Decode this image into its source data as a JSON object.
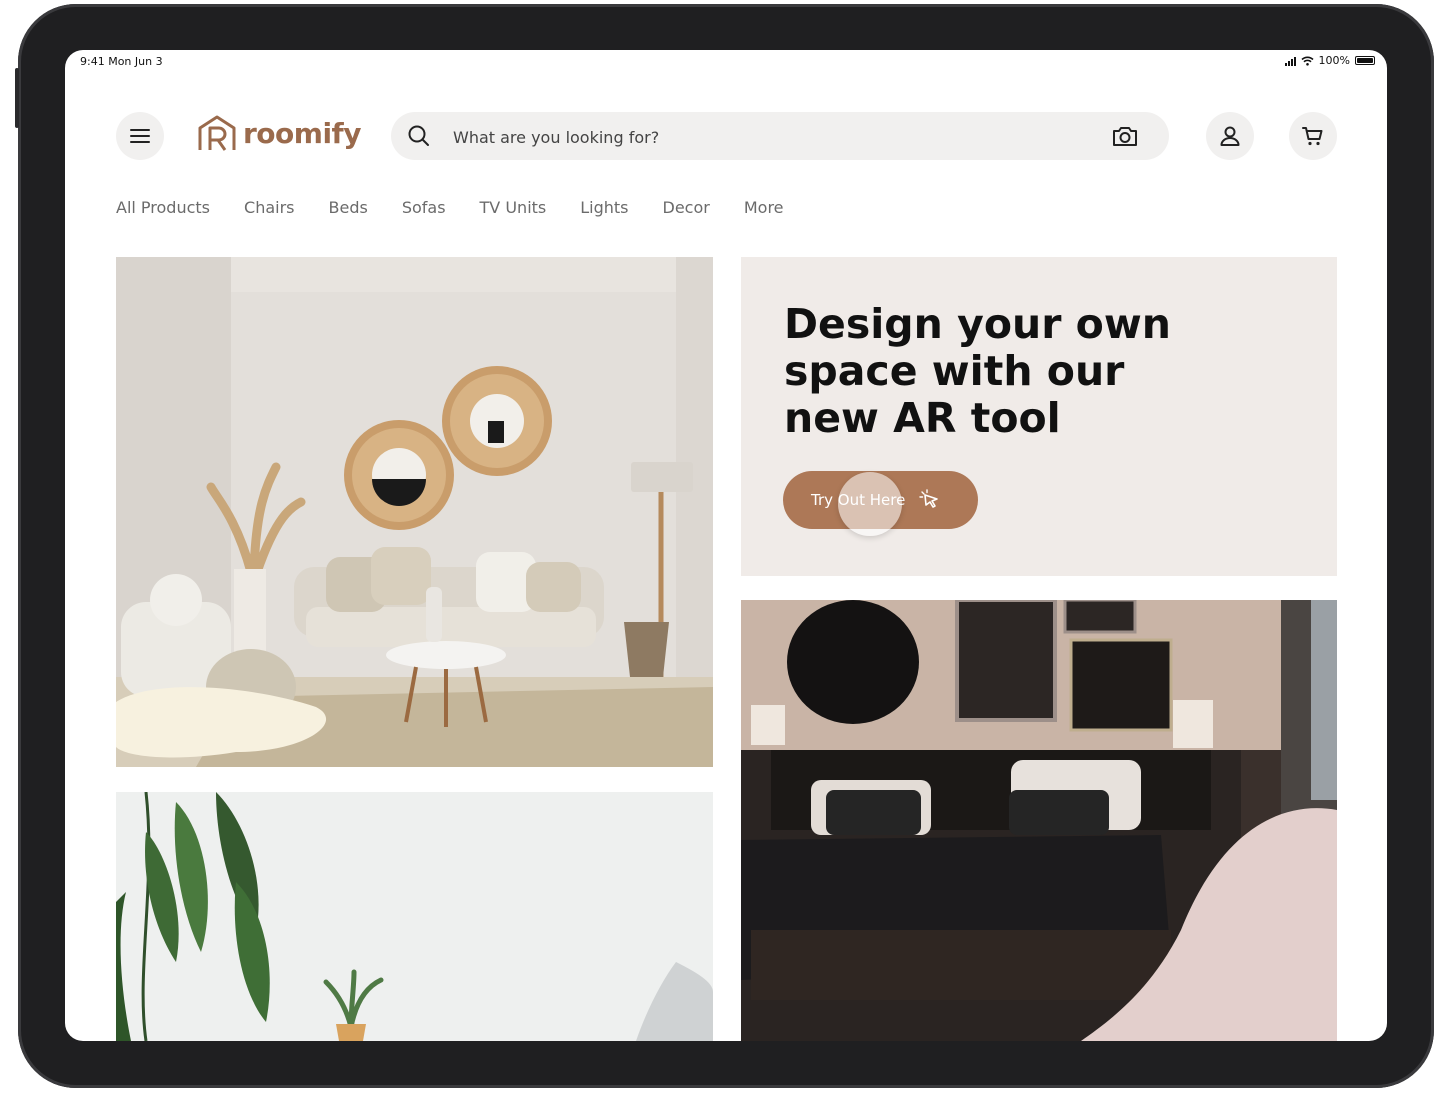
{
  "status_bar": {
    "time": "9:41 Mon Jun 3",
    "battery": "100%"
  },
  "header": {
    "brand": "roomify",
    "search_placeholder": "What are you looking for?",
    "icons": {
      "menu": "menu-icon",
      "search": "search-icon",
      "camera": "camera-icon",
      "account": "user-icon",
      "cart": "cart-icon"
    }
  },
  "nav": {
    "items": [
      "All Products",
      "Chairs",
      "Beds",
      "Sofas",
      "TV Units",
      "Lights",
      "Decor",
      "More"
    ]
  },
  "promo": {
    "title_line1": "Design your own",
    "title_line2": "space with our",
    "title_line3": "new AR tool",
    "cta_label": "Try Out Here",
    "cta_icon": "cursor-click-icon"
  },
  "colors": {
    "brand": "#9a6a4c",
    "cta": "#ad7857",
    "promo_bg": "#f0ebe8",
    "chip_bg": "#f1f0ef"
  }
}
